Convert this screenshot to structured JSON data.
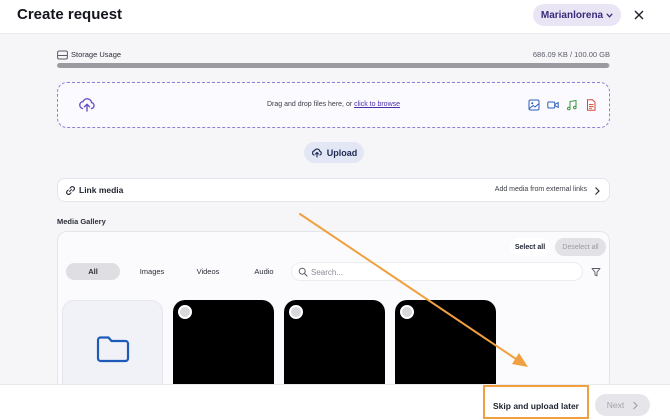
{
  "header": {
    "title": "Create request",
    "user_name": "Marianlorena"
  },
  "storage": {
    "label": "Storage Usage",
    "value": "686.09 KB / 100.00 GB",
    "fill_fraction": 0.999
  },
  "dropzone": {
    "text": "Drag and drop files here, or ",
    "link": "click to browse"
  },
  "upload_button": {
    "label": "Upload"
  },
  "link_media": {
    "label": "Link media",
    "right_text": "Add media from external links"
  },
  "gallery": {
    "title": "Media Gallery",
    "select_all": "Select all",
    "deselect_all": "Deselect all",
    "tabs": [
      "All",
      "Images",
      "Videos",
      "Audio"
    ],
    "search_placeholder": "Search..."
  },
  "footer": {
    "skip_label": "Skip and upload later",
    "next_label": "Next"
  },
  "colors": {
    "accent": "#4b2fa8",
    "highlight": "#f0a040",
    "folder": "#1e5bb8"
  }
}
